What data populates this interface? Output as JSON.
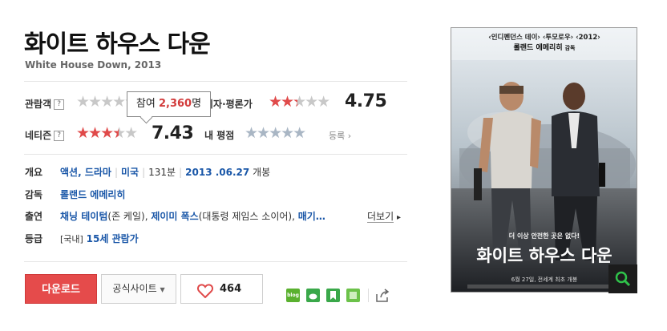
{
  "movie": {
    "title_ko": "화이트 하우스 다운",
    "title_en_year": "White House Down, 2013"
  },
  "ratings": {
    "audience_label": "관람객",
    "critic_label": "기자·평론가",
    "critic_score": "4.75",
    "netizen_label": "네티즌",
    "netizen_score": "7.43",
    "my_rating_label": "내 평점",
    "rate_link": "등록",
    "help_mark": "?"
  },
  "tooltip": {
    "prefix": "참여",
    "count": "2,360",
    "suffix": "명"
  },
  "info": {
    "overview_label": "개요",
    "genres": [
      "액션",
      "드라마"
    ],
    "country": "미국",
    "runtime": "131분",
    "release_date": "2013 .06.27",
    "release_suffix": "개봉",
    "director_label": "감독",
    "director": "롤랜드 에메리히",
    "cast_label": "출연",
    "cast": [
      {
        "name": "채닝 테이텀",
        "role": "(존 케일)"
      },
      {
        "name": "제이미 폭스",
        "role": "(대통령 제임스 소이어)"
      },
      {
        "name": "매기…",
        "role": ""
      }
    ],
    "more_label": "더보기",
    "grade_label": "등급",
    "grade_region": "[국내]",
    "grade_value": "15세 관람가"
  },
  "actions": {
    "download_label": "다운로드",
    "official_site_label": "공식사이트",
    "like_count": "464"
  },
  "share_icons": [
    {
      "name": "blog",
      "color": "#5ab12f",
      "label": "blog"
    },
    {
      "name": "cafe",
      "color": "#3aa84a",
      "label": ""
    },
    {
      "name": "bookmark",
      "color": "#3aa84a",
      "label": ""
    },
    {
      "name": "memo",
      "color": "#6cc24a",
      "label": ""
    }
  ],
  "poster": {
    "top_text_1": "‹인디펜던스 데이› ‹투모로우› ‹2012›",
    "top_text_2": "롤랜드 에메리히",
    "top_text_2_suffix": "감독",
    "tagline": "더 이상 안전한 곳은 없다!",
    "title": "화이트 하우스 다운",
    "release": "6월 27일, 전세계 최초 개봉"
  },
  "colors": {
    "accent_red": "#e54b4b",
    "link_blue": "#1a57a8",
    "star_red": "#e04a4a"
  }
}
